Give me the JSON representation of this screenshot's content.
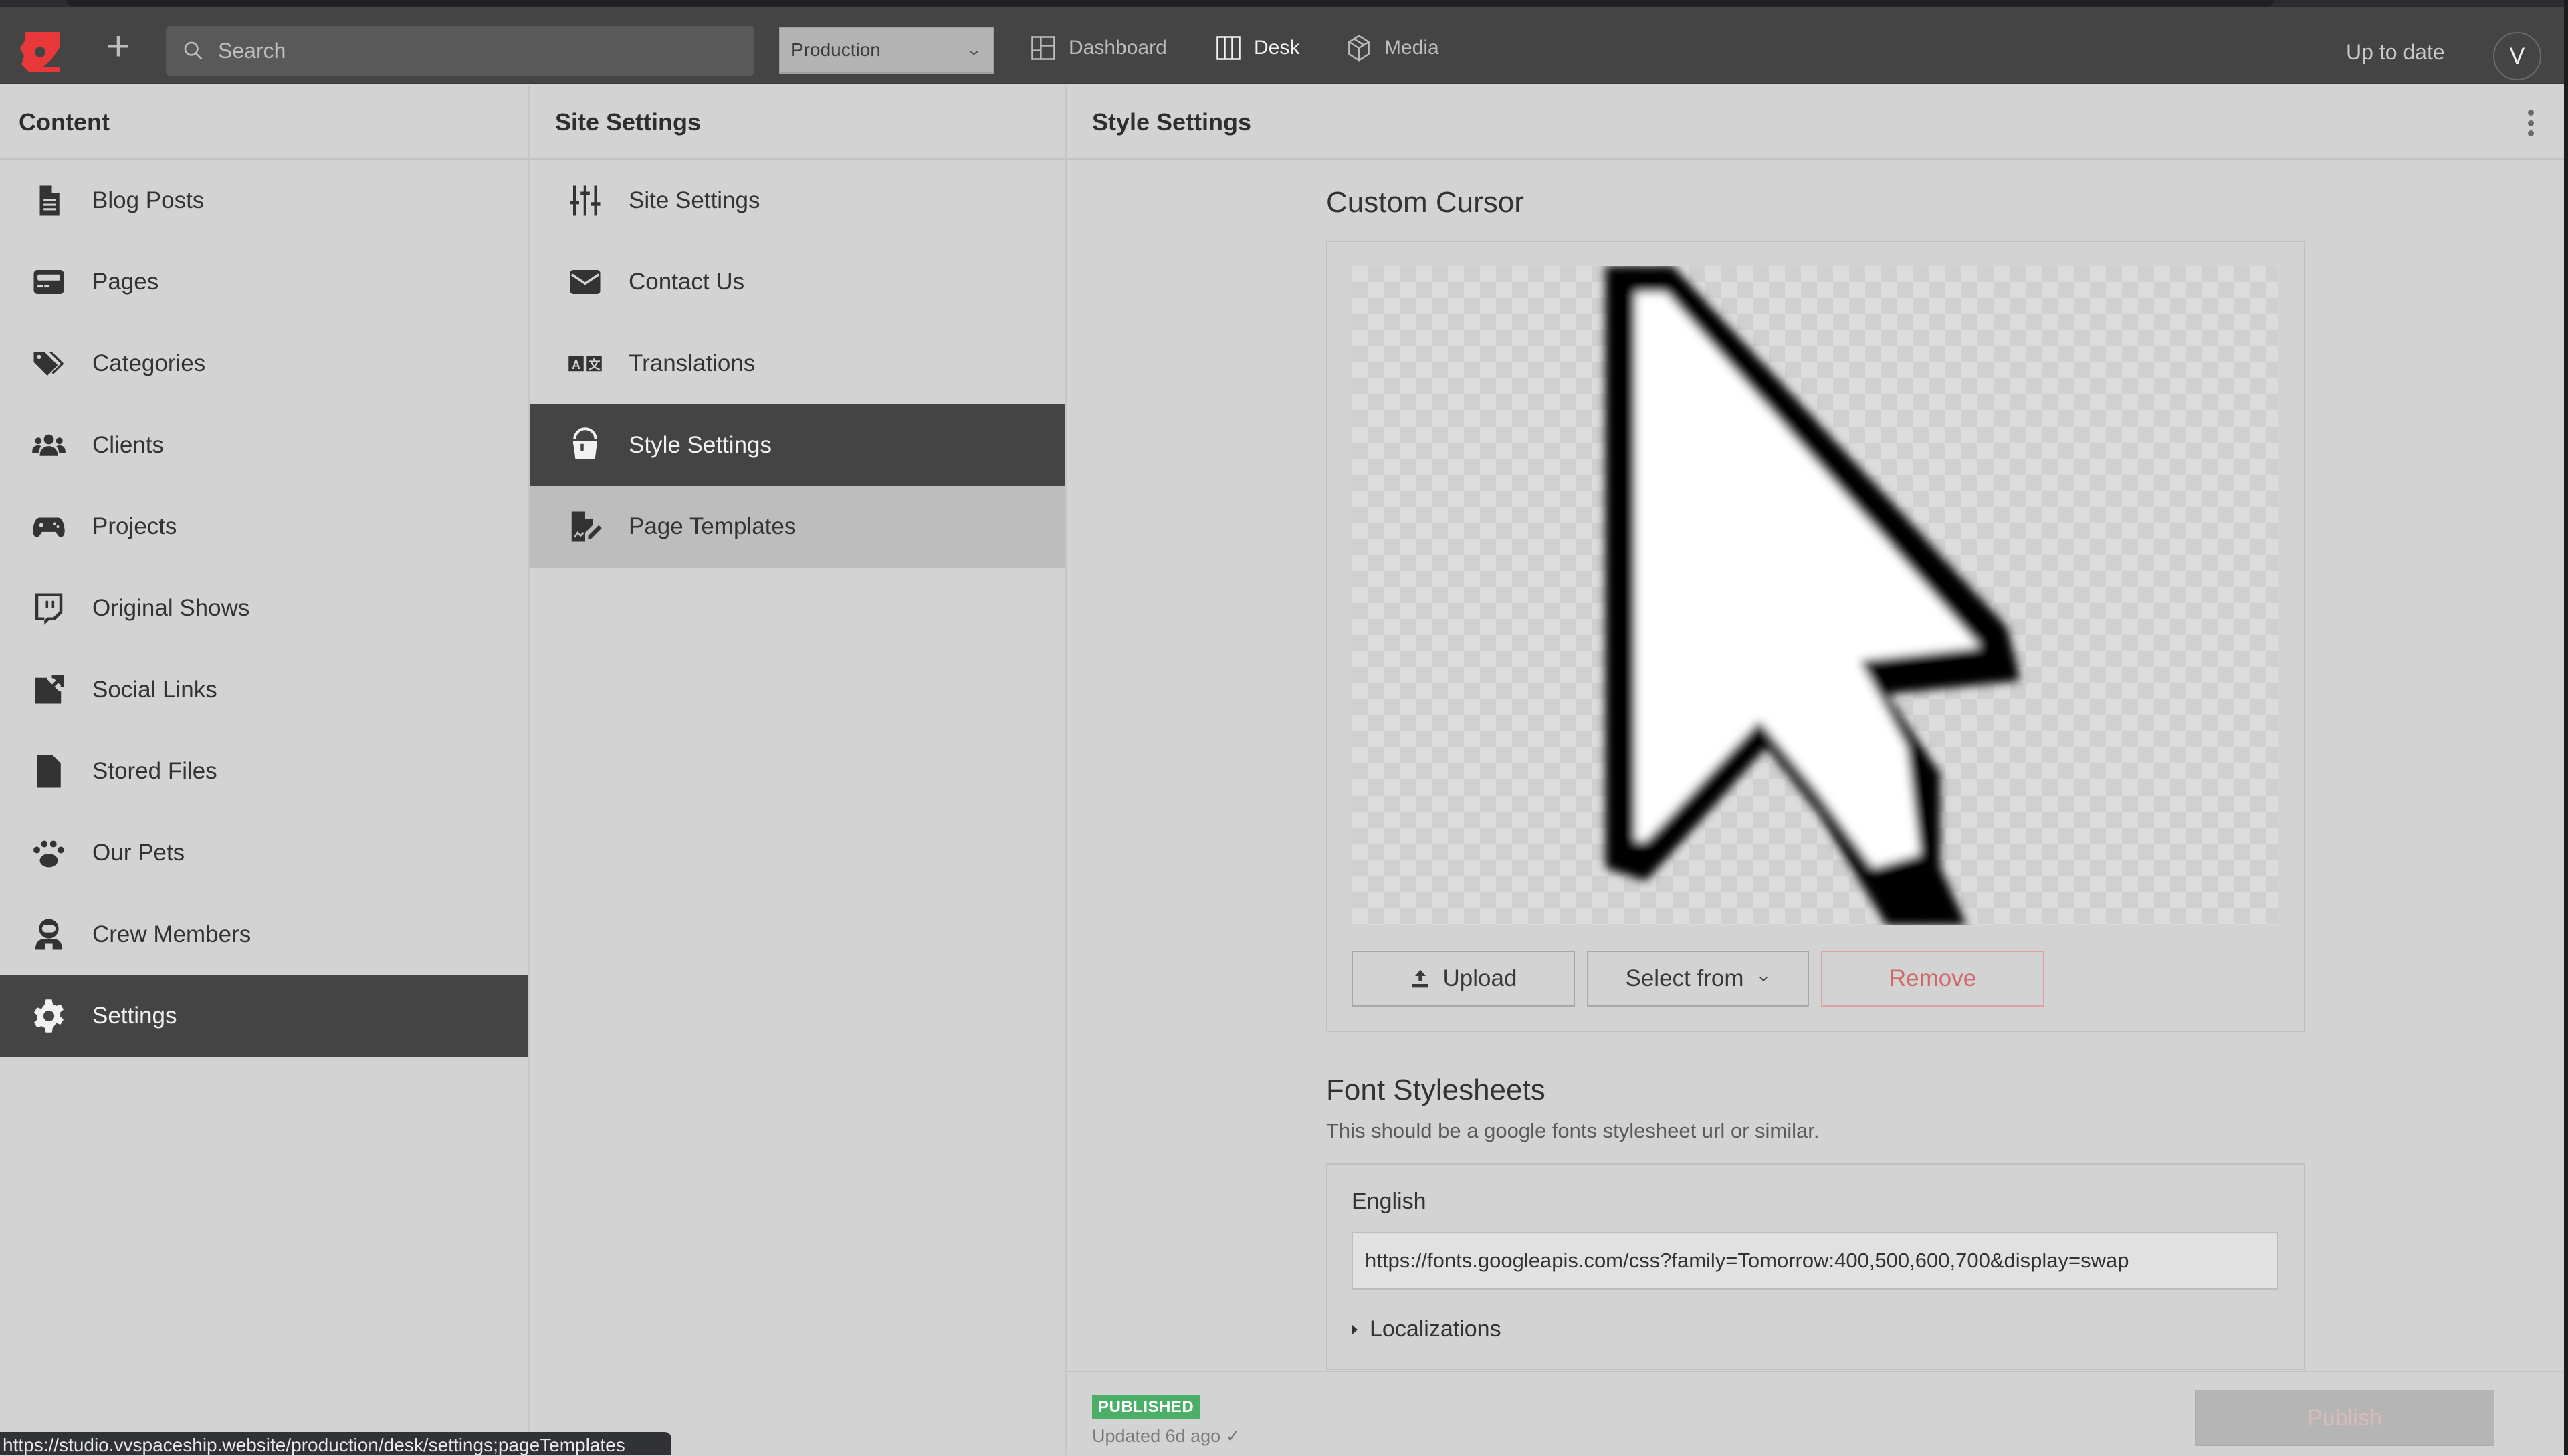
{
  "topbar": {
    "logo": "sanity-logo-icon",
    "new_label": "+",
    "search_placeholder": "Search",
    "dataset": "Production",
    "nav": [
      {
        "label": "Dashboard",
        "icon": "dashboard-icon",
        "active": false
      },
      {
        "label": "Desk",
        "icon": "desk-icon",
        "active": true
      },
      {
        "label": "Media",
        "icon": "media-icon",
        "active": false
      }
    ],
    "status": "Up to date",
    "avatar_initial": "V"
  },
  "content_pane": {
    "title": "Content",
    "items": [
      {
        "label": "Blog Posts",
        "icon": "document-icon"
      },
      {
        "label": "Pages",
        "icon": "page-layout-icon"
      },
      {
        "label": "Categories",
        "icon": "tags-icon"
      },
      {
        "label": "Clients",
        "icon": "users-icon"
      },
      {
        "label": "Projects",
        "icon": "gamepad-icon"
      },
      {
        "label": "Original Shows",
        "icon": "twitch-icon"
      },
      {
        "label": "Social Links",
        "icon": "external-link-icon"
      },
      {
        "label": "Stored Files",
        "icon": "file-text-icon"
      },
      {
        "label": "Our Pets",
        "icon": "paw-icon"
      },
      {
        "label": "Crew Members",
        "icon": "astronaut-icon"
      },
      {
        "label": "Settings",
        "icon": "gear-icon",
        "selected": true
      }
    ]
  },
  "site_settings_pane": {
    "title": "Site Settings",
    "items": [
      {
        "label": "Site Settings",
        "icon": "sliders-icon"
      },
      {
        "label": "Contact Us",
        "icon": "envelope-icon"
      },
      {
        "label": "Translations",
        "icon": "translate-icon"
      },
      {
        "label": "Style Settings",
        "icon": "paint-bucket-icon",
        "selected": true
      },
      {
        "label": "Page Templates",
        "icon": "file-signature-icon",
        "hover": true
      }
    ]
  },
  "document": {
    "title": "Style Settings",
    "custom_cursor": {
      "title": "Custom Cursor",
      "upload_label": "Upload",
      "select_label": "Select from",
      "remove_label": "Remove"
    },
    "font_stylesheets": {
      "title": "Font Stylesheets",
      "description": "This should be a google fonts stylesheet url or similar.",
      "field_label": "English",
      "value": "https://fonts.googleapis.com/css?family=Tomorrow:400,500,600,700&display=swap",
      "localizations_label": "Localizations"
    }
  },
  "footer": {
    "status_badge": "PUBLISHED",
    "updated": "Updated 6d ago ✓",
    "publish_label": "Publish"
  },
  "url_tooltip": "https://studio.vvspaceship.website/production/desk/settings;pageTemplates",
  "colors": {
    "brand": "#e8383a",
    "published": "#4caf68",
    "danger": "#d06868",
    "selected_bg": "#444444"
  }
}
